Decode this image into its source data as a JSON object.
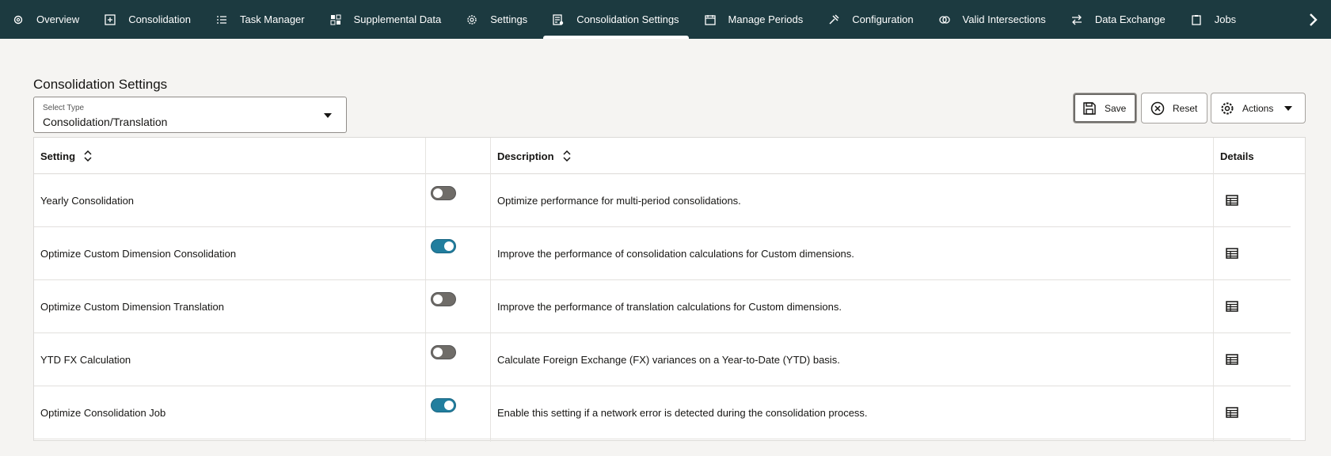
{
  "nav": {
    "items": [
      {
        "label": "Overview",
        "icon": "gear-cog-icon",
        "active": false
      },
      {
        "label": "Consolidation",
        "icon": "consolidation-icon",
        "active": false
      },
      {
        "label": "Task Manager",
        "icon": "task-list-icon",
        "active": false
      },
      {
        "label": "Supplemental Data",
        "icon": "supplemental-data-icon",
        "active": false
      },
      {
        "label": "Settings",
        "icon": "settings-gear-icon",
        "active": false
      },
      {
        "label": "Consolidation Settings",
        "icon": "consolidation-settings-icon",
        "active": true
      },
      {
        "label": "Manage Periods",
        "icon": "calendar-icon",
        "active": false
      },
      {
        "label": "Configuration",
        "icon": "tools-icon",
        "active": false
      },
      {
        "label": "Valid Intersections",
        "icon": "intersection-icon",
        "active": false
      },
      {
        "label": "Data Exchange",
        "icon": "exchange-arrows-icon",
        "active": false
      },
      {
        "label": "Jobs",
        "icon": "clipboard-icon",
        "active": false
      }
    ],
    "more_icon": "chevron-right-icon"
  },
  "page": {
    "title": "Consolidation Settings"
  },
  "select_type": {
    "label": "Select Type",
    "value": "Consolidation/Translation"
  },
  "toolbar": {
    "save_label": "Save",
    "reset_label": "Reset",
    "actions_label": "Actions"
  },
  "table": {
    "headers": {
      "setting": "Setting",
      "description": "Description",
      "details": "Details"
    },
    "rows": [
      {
        "setting": "Yearly Consolidation",
        "enabled": false,
        "description": "Optimize performance for multi-period consolidations."
      },
      {
        "setting": "Optimize Custom Dimension Consolidation",
        "enabled": true,
        "description": "Improve the performance of consolidation calculations for Custom dimensions."
      },
      {
        "setting": "Optimize Custom Dimension Translation",
        "enabled": false,
        "description": "Improve the performance of translation calculations for Custom dimensions."
      },
      {
        "setting": "YTD FX Calculation",
        "enabled": false,
        "description": "Calculate Foreign Exchange (FX) variances on a Year-to-Date (YTD) basis."
      },
      {
        "setting": "Optimize Consolidation Job",
        "enabled": true,
        "description": "Enable this setting if a network error is detected during the consolidation process."
      }
    ]
  },
  "colors": {
    "nav_bg": "#1c3a40",
    "toggle_on": "#227e9e",
    "toggle_off": "#6f6c68"
  }
}
